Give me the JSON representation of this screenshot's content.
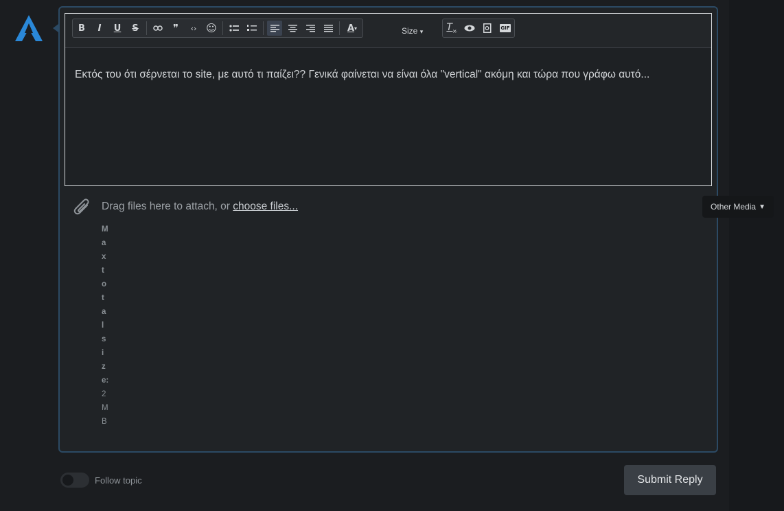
{
  "toolbar": {
    "bold": "B",
    "italic": "I",
    "underline": "U",
    "strike": "S",
    "size_label": "Size",
    "gif_label": "GIF"
  },
  "editor": {
    "text": "Εκτός του ότι σέρνεται το site, με αυτό τι παίζει?? Γενικά φαίνεται να είναι όλα \"vertical\" ακόμη και τώρα που γράφω αυτό..."
  },
  "attachments": {
    "drag_text": "Drag files here to attach, or ",
    "choose_link": "choose files...",
    "max_label": "Max total size: ",
    "max_value": "2MB"
  },
  "other_media": {
    "label": "Other Media"
  },
  "follow": {
    "label": "Follow topic",
    "enabled": false
  },
  "submit": {
    "label": "Submit Reply"
  },
  "colors": {
    "accent": "#2c4a64",
    "logo": "#2a88d8"
  }
}
